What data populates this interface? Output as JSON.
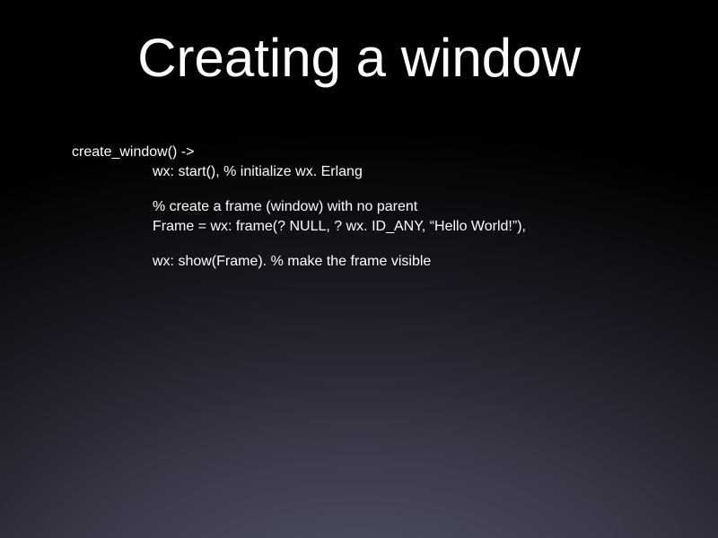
{
  "title": "Creating a window",
  "code": {
    "line1": "create_window() ->",
    "line2": "wx: start(), % initialize wx. Erlang",
    "line3": "% create a frame (window) with no parent",
    "line4": "Frame = wx: frame(? NULL, ? wx. ID_ANY, “Hello World!”),",
    "line5": "wx: show(Frame). % make the frame visible"
  }
}
